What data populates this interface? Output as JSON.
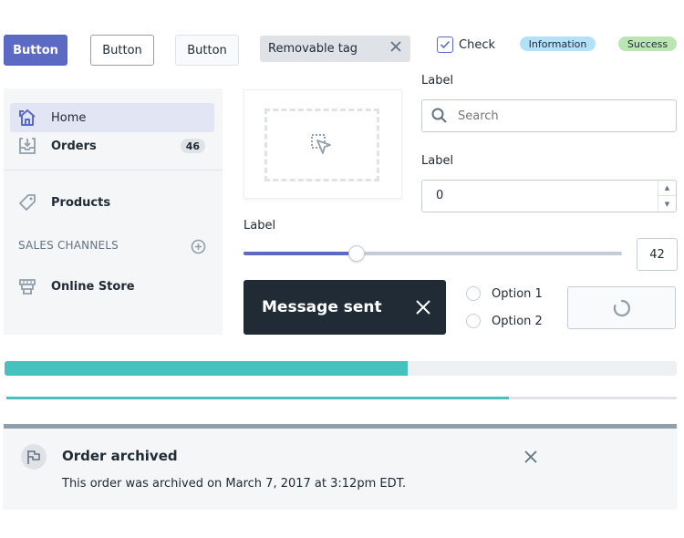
{
  "buttons": {
    "primary": "Button",
    "outline": "Button",
    "plain": "Button"
  },
  "tag": {
    "label": "Removable tag",
    "remove_icon": "close-icon"
  },
  "checkbox": {
    "label": "Check",
    "checked": true
  },
  "badges": [
    {
      "label": "Information",
      "color": "#b4e1fa"
    },
    {
      "label": "Success",
      "color": "#bbe5b3"
    }
  ],
  "sidebar": {
    "items": [
      {
        "label": "Home",
        "icon": "home-icon",
        "active": true
      },
      {
        "label": "Orders",
        "icon": "orders-icon",
        "count": "46"
      },
      {
        "label": "Products",
        "icon": "tag-icon"
      }
    ],
    "section": {
      "title": "SALES CHANNELS",
      "add_icon": "plus-circle-icon"
    },
    "channels": [
      {
        "label": "Online Store",
        "icon": "store-icon"
      }
    ]
  },
  "dropzone": {
    "icon": "select-cursor-icon"
  },
  "search_field": {
    "label": "Label",
    "placeholder": "Search",
    "icon": "search-icon"
  },
  "number_field": {
    "label": "Label",
    "value": "0"
  },
  "slider": {
    "label": "Label",
    "value": 42,
    "min": 0,
    "max": 100,
    "display": "42"
  },
  "toast": {
    "message": "Message sent",
    "close_icon": "close-icon"
  },
  "radios": [
    {
      "label": "Option 1",
      "checked": false
    },
    {
      "label": "Option 2",
      "checked": false
    }
  ],
  "spinner_card": {
    "icon": "spinner-icon"
  },
  "progress": [
    {
      "percent": 60
    },
    {
      "percent": 75
    }
  ],
  "banner": {
    "title": "Order archived",
    "body": "This order was archived on March 7, 2017 at 3:12pm EDT.",
    "icon": "flag-icon",
    "close_icon": "close-icon"
  },
  "colors": {
    "primary": "#5c6ac4",
    "teal": "#47c1bf",
    "ink": "#212b36",
    "subdued": "#637381"
  }
}
